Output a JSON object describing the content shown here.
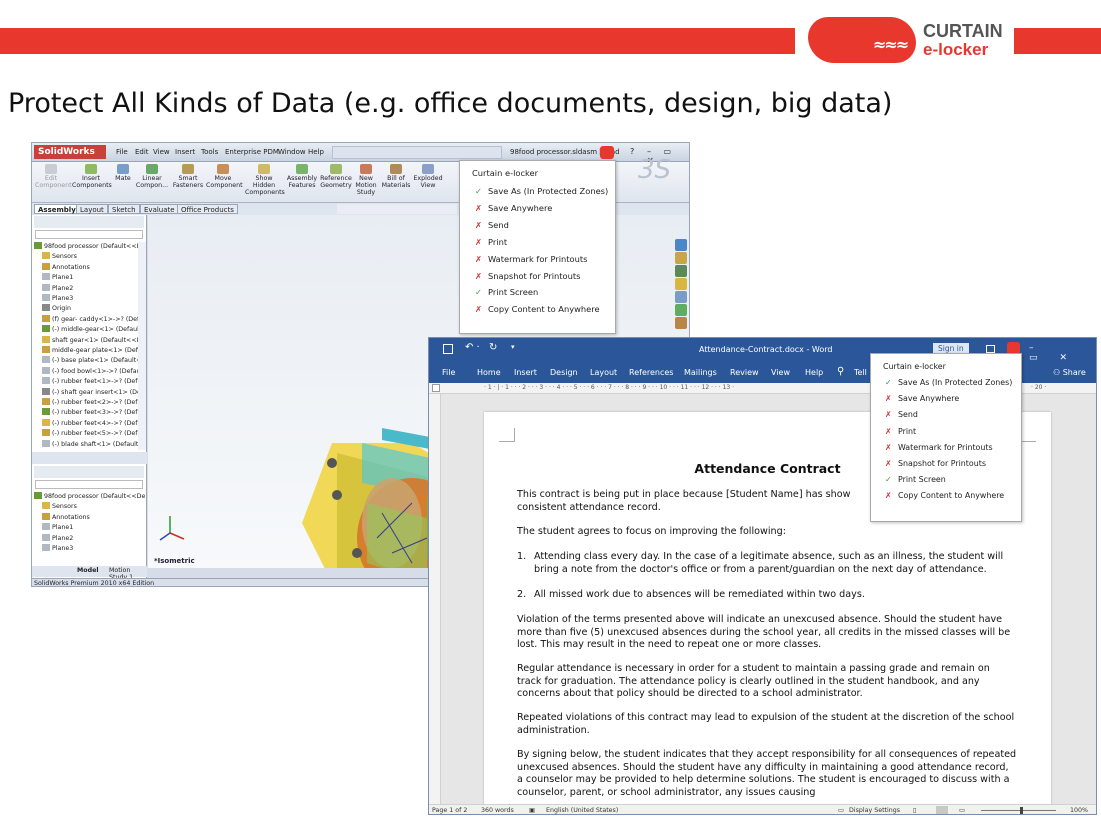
{
  "header": {
    "logo_line1": "CURTAIN",
    "logo_line2": "e-locker",
    "logo_eye": "≈≈≈",
    "slide_title": "Protect All Kinds of Data (e.g. office documents, design, big data)"
  },
  "colors": {
    "brand_red": "#e8382e",
    "word_blue": "#2b579a",
    "ok_green": "#3c9a3c",
    "deny_red": "#d22b2b"
  },
  "solidworks": {
    "logo": "SolidWorks",
    "menu": [
      "File",
      "Edit",
      "View",
      "Insert",
      "Tools",
      "Enterprise PDM",
      "Window",
      "Help"
    ],
    "doc_title": "98food processor.sldasm [Read",
    "ribbon": [
      "Edit Component",
      "Insert Components",
      "Mate",
      "Linear Compon...",
      "Smart Fasteners",
      "Move Component",
      "Show Hidden Components",
      "Assembly Features",
      "Reference Geometry",
      "New Motion Study",
      "Bill of Materials",
      "Exploded View"
    ],
    "tabs": [
      "Assembly",
      "Layout",
      "Sketch",
      "Evaluate",
      "Office Products"
    ],
    "tree_top": [
      "98food processor  (Default<<De",
      "Sensors",
      "Annotations",
      "Plane1",
      "Plane2",
      "Plane3",
      "Origin",
      "(f) gear- caddy<1>->? (Def-",
      "(-) middle-gear<1> (Default",
      "shaft gear<1> (Default<<D",
      "middle-gear plate<1> (Defa",
      "(-) base plate<1> (Default<",
      "(-) food bowl<1>->? (Defau",
      "(-) rubber feet<1>->? (Def",
      "(-) shaft gear insert<1> (De",
      "(-) rubber feet<2>->? (Defa",
      "(-) rubber feet<3>->? (Defa",
      "(-) rubber feet<4>->? (Defa",
      "(-) rubber feet<5>->? (Defa",
      "(-) blade shaft<1> (Default"
    ],
    "tree_bottom": [
      "98food processor  (Default<<De",
      "Sensors",
      "Annotations",
      "Plane1",
      "Plane2",
      "Plane3"
    ],
    "bottom_tabs": [
      "Model",
      "Motion Study 1"
    ],
    "view_label": "*Isometric",
    "status": "SolidWorks Premium 2010 x64 Edition"
  },
  "curtain_menu_sw": {
    "title": "Curtain e-locker",
    "items": [
      {
        "label": "Save As (In Protected Zones)",
        "mark": "✓",
        "ok": true
      },
      {
        "label": "Save Anywhere",
        "mark": "✗",
        "ok": false
      },
      {
        "label": "Send",
        "mark": "✗",
        "ok": false
      },
      {
        "label": "Print",
        "mark": "✗",
        "ok": false
      },
      {
        "label": "Watermark for Printouts",
        "mark": "✗",
        "ok": false
      },
      {
        "label": "Snapshot for Printouts",
        "mark": "✗",
        "ok": false
      },
      {
        "label": "Print Screen",
        "mark": "✓",
        "ok": true
      },
      {
        "label": "Copy Content to Anywhere",
        "mark": "✗",
        "ok": false
      }
    ]
  },
  "word": {
    "title": "Attendance-Contract.docx - Word",
    "signin": "Sign in",
    "tabs": [
      "File",
      "Home",
      "Insert",
      "Design",
      "Layout",
      "References",
      "Mailings",
      "Review",
      "View",
      "Help",
      "Tell"
    ],
    "share": "Share",
    "ruler": "· 1 · | · 1 · · · 2 · · · 3 · · · 4 · · · 5 · · · 6 · · · 7 · · · 8 · · · 9 · · · 10 · · · 11 · · · 12 · · · 13 ·",
    "ruler_end": "· 20 ·",
    "status_page": "Page 1 of 2",
    "status_words": "360 words",
    "status_lang": "English (United States)",
    "status_display": "Display Settings",
    "status_zoom": "100%",
    "doc": {
      "title": "Attendance Contract",
      "p1": "This contract is being put in place because [Student Name] has show",
      "p1b": "consistent attendance record.",
      "p2": "The student agrees to focus on improving the following:",
      "li1_num": "1.",
      "li1": "Attending class every day. In the case of a legitimate absence, such as an illness, the student will bring a note from the doctor's office or from a parent/guardian on the next day of attendance.",
      "li2_num": "2.",
      "li2": "All missed work due to absences will be remediated within two days.",
      "p3": "Violation of the terms presented above will indicate an unexcused absence. Should the student have more than five (5) unexcused absences during the school year, all credits in the missed classes will be lost. This may result in the need to repeat one or more classes.",
      "p4": "Regular attendance is necessary in order for a student to maintain a passing grade and remain on track for graduation. The attendance policy is clearly outlined in the student handbook, and any concerns about that policy should be directed to a school administrator.",
      "p5": "Repeated violations of this contract may lead to expulsion of the student at the discretion of the school administration.",
      "p6": "By signing below, the student indicates that they accept responsibility for all consequences of repeated unexcused absences. Should the student have any difficulty in maintaining a good attendance record, a counselor may be provided to help determine solutions. The student is encouraged to discuss with a counselor, parent, or school administrator, any issues causing"
    }
  },
  "curtain_menu_word": {
    "title": "Curtain e-locker",
    "items": [
      {
        "label": "Save As (In Protected Zones)",
        "mark": "✓",
        "ok": true
      },
      {
        "label": "Save Anywhere",
        "mark": "✗",
        "ok": false
      },
      {
        "label": "Send",
        "mark": "✗",
        "ok": false
      },
      {
        "label": "Print",
        "mark": "✗",
        "ok": false
      },
      {
        "label": "Watermark for Printouts",
        "mark": "✗",
        "ok": false
      },
      {
        "label": "Snapshot for Printouts",
        "mark": "✗",
        "ok": false
      },
      {
        "label": "Print Screen",
        "mark": "✓",
        "ok": true
      },
      {
        "label": "Copy Content to Anywhere",
        "mark": "✗",
        "ok": false
      }
    ]
  }
}
